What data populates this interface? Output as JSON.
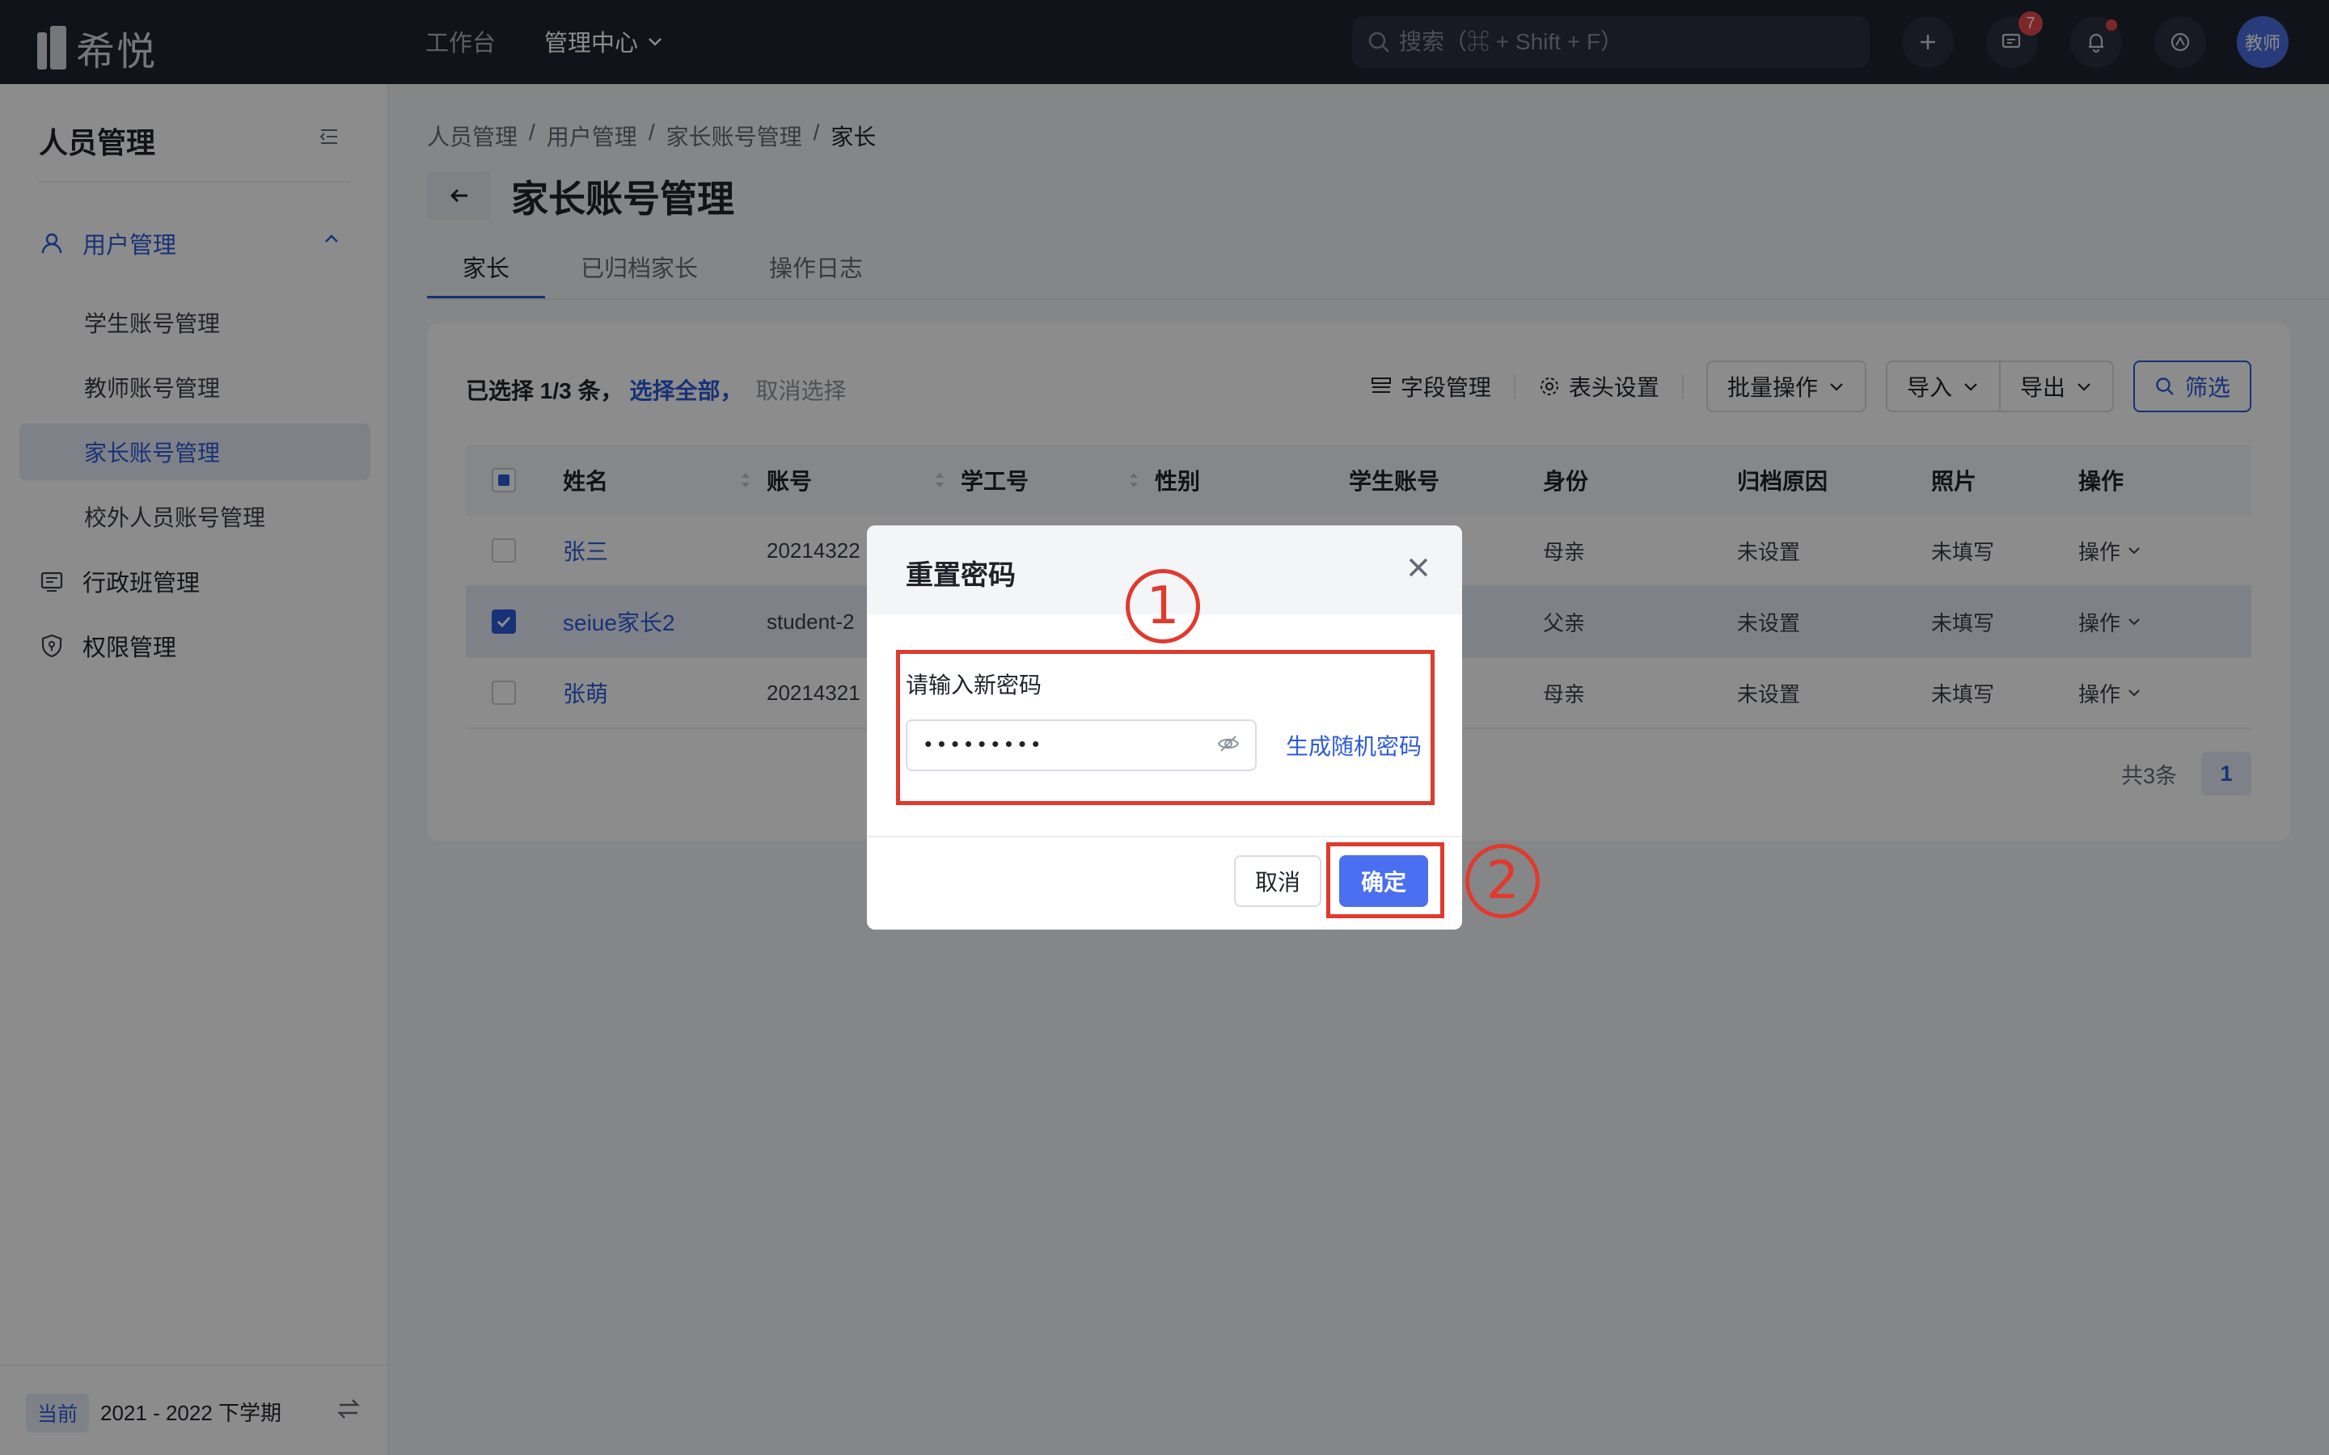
{
  "topbar": {
    "logo_text": "希悦",
    "nav": [
      {
        "label": "工作台"
      },
      {
        "label": "管理中心"
      }
    ],
    "search_placeholder": "搜索（⌘ + Shift + F）",
    "messages_badge": "7",
    "avatar_text": "教师"
  },
  "sidebar": {
    "title": "人员管理",
    "group_label": "用户管理",
    "sub_items": [
      {
        "label": "学生账号管理"
      },
      {
        "label": "教师账号管理"
      },
      {
        "label": "家长账号管理"
      },
      {
        "label": "校外人员账号管理"
      }
    ],
    "items": [
      {
        "label": "行政班管理"
      },
      {
        "label": "权限管理"
      }
    ],
    "term_tag": "当前",
    "term_text": "2021 - 2022 下学期"
  },
  "main": {
    "breadcrumb": [
      "人员管理",
      "用户管理",
      "家长账号管理",
      "家长"
    ],
    "breadcrumb_sep": "/",
    "title": "家长账号管理",
    "tabs": [
      {
        "label": "家长"
      },
      {
        "label": "已归档家长"
      },
      {
        "label": "操作日志"
      }
    ],
    "selection": {
      "text": "已选择 1/3 条，",
      "select_all": "选择全部，",
      "cancel": "取消选择"
    },
    "toolbar": {
      "fields": "字段管理",
      "header_settings": "表头设置",
      "batch": "批量操作",
      "import": "导入",
      "export": "导出",
      "filter": "筛选"
    },
    "table": {
      "headers": [
        "姓名",
        "账号",
        "学工号",
        "性别",
        "学生账号",
        "身份",
        "归档原因",
        "照片",
        "操作"
      ],
      "rows": [
        {
          "name": "张三",
          "account": "20214322",
          "identity": "母亲",
          "reason": "未设置",
          "photo": "未填写",
          "action": "操作",
          "checked": false
        },
        {
          "name": "seiue家长2",
          "account": "student-2",
          "identity": "父亲",
          "reason": "未设置",
          "photo": "未填写",
          "action": "操作",
          "checked": true
        },
        {
          "name": "张萌",
          "account": "20214321",
          "identity": "母亲",
          "reason": "未设置",
          "photo": "未填写",
          "action": "操作",
          "checked": false
        }
      ]
    },
    "pager": {
      "total": "共3条",
      "current": "1"
    }
  },
  "modal": {
    "title": "重置密码",
    "label": "请输入新密码",
    "password_value": "•••••••••",
    "generate_link": "生成随机密码",
    "cancel": "取消",
    "confirm": "确定"
  },
  "annotations": {
    "step1": "1",
    "step2": "2"
  },
  "colors": {
    "accent": "#2d5bd9",
    "primary_button": "#4a6ff0",
    "annotation": "#e03a2f",
    "topbar": "#1f2330"
  }
}
